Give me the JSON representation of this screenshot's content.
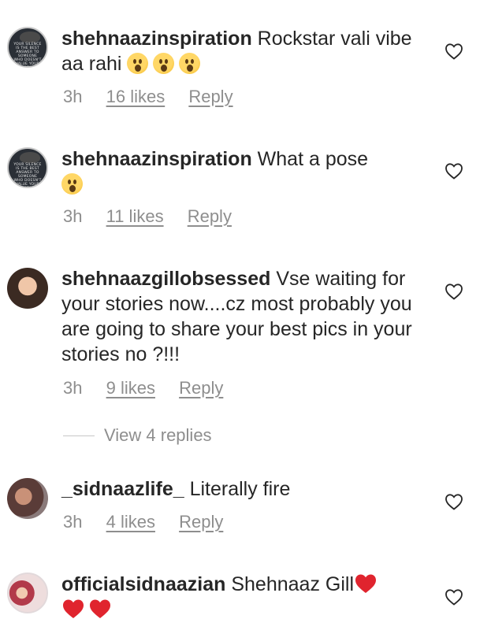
{
  "comments": [
    {
      "username": "shehnaazinspiration",
      "text": "Rockstar vali vibe aa rahi",
      "avatar_quote": "YOUR SILENCE IS THE BEST ANSWER TO SOMEONE WHO DOESN'T VALUE YOUR WORDS",
      "time": "3h",
      "likes": "16 likes",
      "reply": "Reply"
    },
    {
      "username": "shehnaazinspiration",
      "text": "What a pose",
      "avatar_quote": "YOUR SILENCE IS THE BEST ANSWER TO SOMEONE WHO DOESN'T VALUE YOUR WORDS",
      "time": "3h",
      "likes": "11 likes",
      "reply": "Reply"
    },
    {
      "username": "shehnaazgillobsessed",
      "text": "Vse waiting for your stories now....cz most probably you are going to share your best pics in your stories no ?!!!",
      "time": "3h",
      "likes": "9 likes",
      "reply": "Reply",
      "view_replies": "View 4 replies"
    },
    {
      "username": "_sidnaazlife_",
      "text": "Literally fire",
      "time": "3h",
      "likes": "4 likes",
      "reply": "Reply"
    },
    {
      "username": "officialsidnaazian",
      "text": "Shehnaaz Gill"
    }
  ],
  "colors": {
    "text": "#262626",
    "meta": "#8e8e8e",
    "heart_emoji": "#e0242e",
    "emoji_face": "#ffd766"
  },
  "icons": {
    "like": "heart-outline-icon",
    "emoji_surprised": "astonished-face-emoji",
    "emoji_heart": "red-heart-emoji"
  }
}
